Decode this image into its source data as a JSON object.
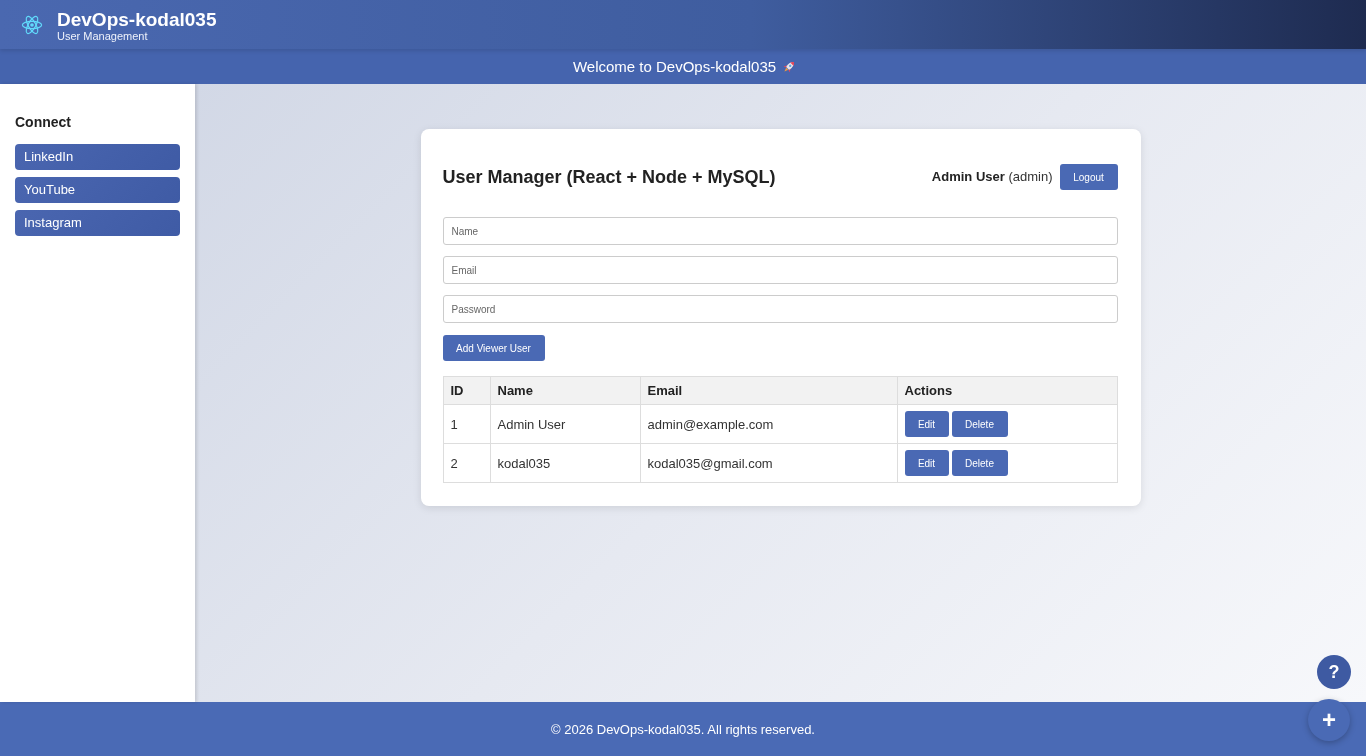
{
  "header": {
    "title": "DevOps-kodal035",
    "subtitle": "User Management"
  },
  "banner": {
    "text": "Welcome to DevOps-kodal035"
  },
  "sidebar": {
    "heading": "Connect",
    "links": [
      {
        "label": "LinkedIn"
      },
      {
        "label": "YouTube"
      },
      {
        "label": "Instagram"
      }
    ]
  },
  "panel": {
    "title": "User Manager (React + Node + MySQL)",
    "user": {
      "name": "Admin User",
      "role": "(admin)"
    },
    "logout_button": "Logout",
    "form": {
      "fields": [
        {
          "placeholder": "Name"
        },
        {
          "placeholder": "Email"
        },
        {
          "placeholder": "Password"
        }
      ],
      "submit_button": "Add Viewer User"
    },
    "table": {
      "columns": [
        "ID",
        "Name",
        "Email",
        "Actions"
      ],
      "rows": [
        {
          "cells": [
            "1",
            "Admin User",
            "admin@example.com"
          ],
          "actions": [
            "Edit",
            "Delete"
          ]
        },
        {
          "cells": [
            "2",
            "kodal035",
            "kodal035@gmail.com"
          ],
          "actions": [
            "Edit",
            "Delete"
          ]
        }
      ]
    }
  },
  "footer": {
    "text": "© 2026 DevOps-kodal035. All rights reserved."
  },
  "floating_buttons": [
    {
      "kind": "help",
      "label": "?"
    },
    {
      "kind": "add",
      "label": "+"
    }
  ]
}
